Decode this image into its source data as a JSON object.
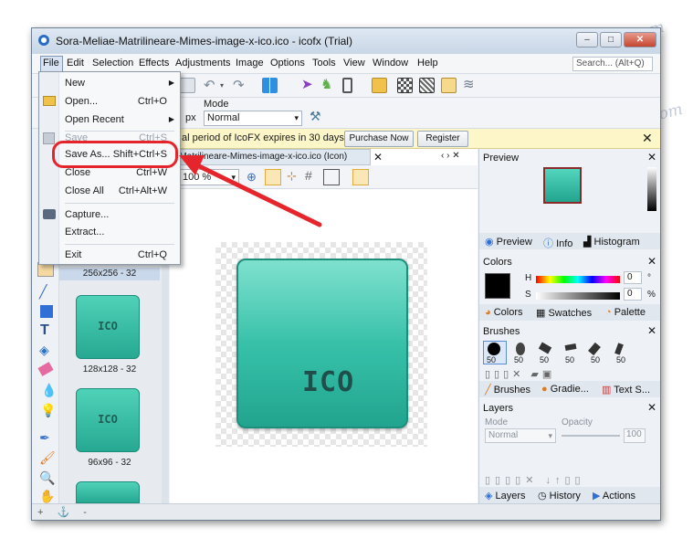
{
  "window": {
    "title": "Sora-Meliae-Matrilineare-Mimes-image-x-ico.ico - icofx (Trial)",
    "buttons": [
      "–",
      "□",
      "✕"
    ]
  },
  "menubar": {
    "items": [
      "File",
      "Edit",
      "Selection",
      "Effects",
      "Adjustments",
      "Image",
      "Options",
      "Tools",
      "View",
      "Window",
      "Help"
    ],
    "search_placeholder": "Search... (Alt+Q)"
  },
  "options_bar": {
    "mode_label": "Mode",
    "mode_value": "Normal",
    "unit": "px"
  },
  "trial_bar": {
    "message": "al period of IcoFX expires in 30 days.",
    "purchase_button": "Purchase Now",
    "register_button": "Register"
  },
  "document": {
    "tab_label": "-Matrilineare-Mimes-image-x-ico.ico (Icon)",
    "zoom": "100 %",
    "icon_text": "ICO"
  },
  "thumbnails": [
    {
      "label": "256x256 - 32",
      "text": ""
    },
    {
      "label": "128x128 - 32",
      "text": "ICO"
    },
    {
      "label": "96x96 - 32",
      "text": "ICO"
    }
  ],
  "file_menu": {
    "items": [
      {
        "label": "New",
        "shortcut": "",
        "submenu": true,
        "disabled": false
      },
      {
        "label": "Open...",
        "shortcut": "Ctrl+O",
        "submenu": false,
        "disabled": false
      },
      {
        "label": "Open Recent",
        "shortcut": "",
        "submenu": true,
        "disabled": false
      },
      {
        "label": "Save",
        "shortcut": "Ctrl+S",
        "submenu": false,
        "disabled": true
      },
      {
        "label": "Save As...",
        "shortcut": "Shift+Ctrl+S",
        "submenu": false,
        "disabled": false
      },
      {
        "label": "Close",
        "shortcut": "Ctrl+W",
        "submenu": false,
        "disabled": false
      },
      {
        "label": "Close All",
        "shortcut": "Ctrl+Alt+W",
        "submenu": false,
        "disabled": false
      },
      {
        "label": "Capture...",
        "shortcut": "",
        "submenu": false,
        "disabled": false
      },
      {
        "label": "Extract...",
        "shortcut": "",
        "submenu": false,
        "disabled": false
      },
      {
        "label": "Exit",
        "shortcut": "Ctrl+Q",
        "submenu": false,
        "disabled": false
      }
    ]
  },
  "right_panel": {
    "preview_title": "Preview",
    "preview_tabs": [
      "Preview",
      "Info",
      "Histogram"
    ],
    "colors_title": "Colors",
    "h_label": "H",
    "s_label": "S",
    "h_value": "0",
    "s_value": "0",
    "h_unit": "°",
    "s_unit": "%",
    "colors_tabs": [
      "Colors",
      "Swatches",
      "Palette"
    ],
    "brushes_title": "Brushes",
    "brush_sizes": [
      "50",
      "50",
      "50",
      "50",
      "50",
      "50"
    ],
    "brushes_tabs": [
      "Brushes",
      "Gradie...",
      "Text S..."
    ],
    "layers_title": "Layers",
    "layers_mode_label": "Mode",
    "layers_mode_value": "Normal",
    "layers_opacity_label": "Opacity",
    "layers_opacity_value": "100",
    "layers_tabs": [
      "Layers",
      "History",
      "Actions"
    ]
  },
  "watermark": "Soringpcrepair.com",
  "colors": {
    "accent_red": "#e5252b",
    "icon_teal": "#33bca5",
    "trial_bg": "#fdf6c8"
  }
}
